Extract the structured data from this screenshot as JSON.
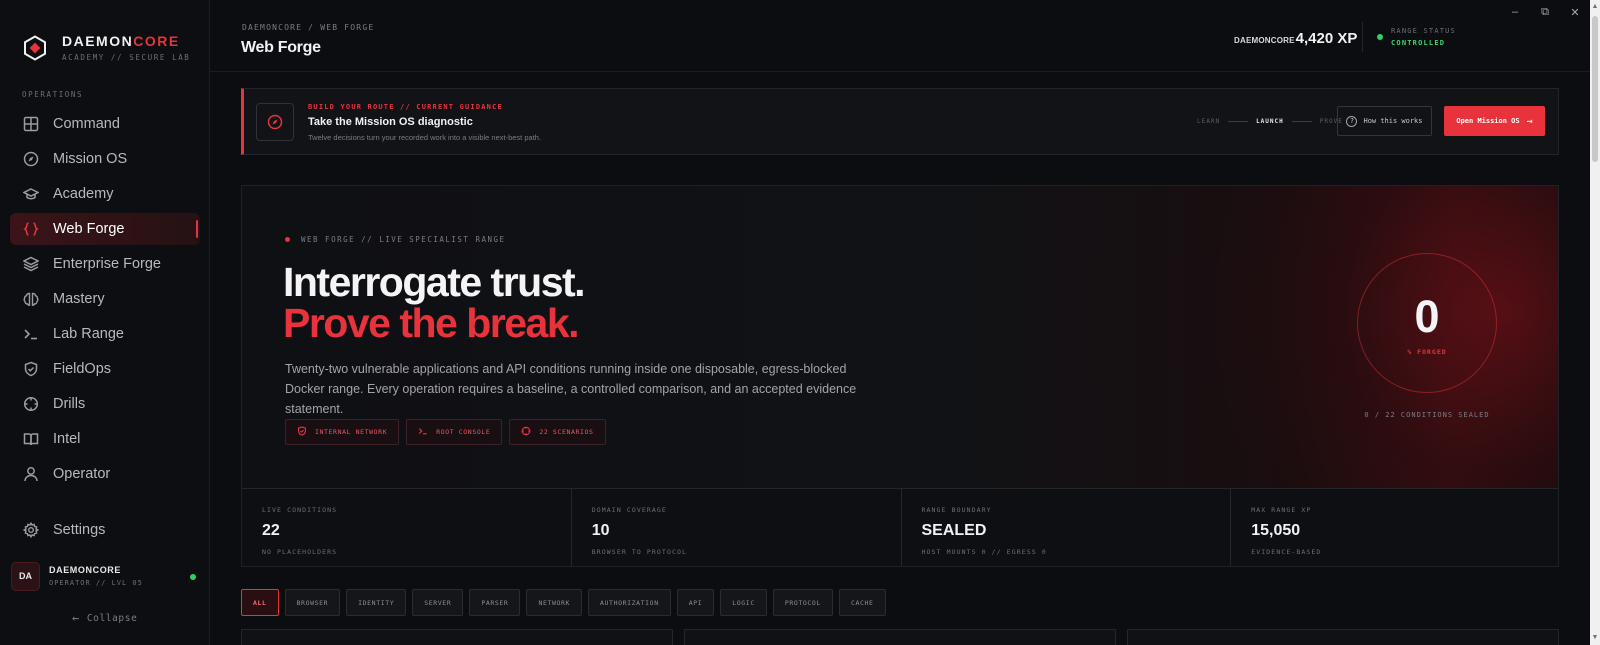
{
  "brand": {
    "name_main": "DAEMON",
    "name_accent": "CORE",
    "tagline": "ACADEMY // SECURE LAB"
  },
  "sidebar": {
    "section_label": "OPERATIONS",
    "items": [
      {
        "label": "Command",
        "icon": "grid-icon"
      },
      {
        "label": "Mission OS",
        "icon": "compass-icon"
      },
      {
        "label": "Academy",
        "icon": "graduation-cap-icon"
      },
      {
        "label": "Web Forge",
        "icon": "braces-icon",
        "active": true
      },
      {
        "label": "Enterprise Forge",
        "icon": "layers-icon"
      },
      {
        "label": "Mastery",
        "icon": "brain-icon"
      },
      {
        "label": "Lab Range",
        "icon": "terminal-icon"
      },
      {
        "label": "FieldOps",
        "icon": "shield-check-icon"
      },
      {
        "label": "Drills",
        "icon": "crosshair-icon"
      },
      {
        "label": "Intel",
        "icon": "book-icon"
      },
      {
        "label": "Operator",
        "icon": "user-icon"
      }
    ],
    "settings_label": "Settings",
    "user": {
      "initials": "DA",
      "name": "DAEMONCORE",
      "level": "OPERATOR // LVL 05"
    },
    "collapse_label": "Collapse"
  },
  "topbar": {
    "breadcrumb": "DAEMONCORE / WEB FORGE",
    "title": "Web Forge",
    "xp_user": "DAEMONCORE",
    "xp_value": "4,420 XP",
    "range_status_label": "RANGE STATUS",
    "range_status_value": "CONTROLLED"
  },
  "guide": {
    "kicker": "BUILD YOUR ROUTE // CURRENT GUIDANCE",
    "title": "Take the Mission OS diagnostic",
    "subtitle": "Twelve decisions turn your recorded work into a visible next-best path.",
    "steps": [
      "LEARN",
      "LAUNCH",
      "PROVE"
    ],
    "how_label": "How this works",
    "open_label": "Open Mission OS"
  },
  "hero": {
    "tag": "WEB FORGE // LIVE SPECIALIST RANGE",
    "headline_1": "Interrogate trust.",
    "headline_2": "Prove the break.",
    "description": "Twenty-two vulnerable applications and API conditions running inside one disposable, egress-blocked Docker range. Every operation requires a baseline, a controlled comparison, and an accepted evidence statement.",
    "chips": [
      {
        "label": "INTERNAL NETWORK",
        "icon": "shield-icon"
      },
      {
        "label": "ROOT CONSOLE",
        "icon": "terminal-icon"
      },
      {
        "label": "22 SCENARIOS",
        "icon": "crosshair-icon"
      }
    ],
    "progress_value": "0",
    "progress_label": "% FORGED",
    "sealed_note": "0 / 22 CONDITIONS SEALED"
  },
  "stats": [
    {
      "key": "LIVE CONDITIONS",
      "value": "22",
      "sub": "NO PLACEHOLDERS"
    },
    {
      "key": "DOMAIN COVERAGE",
      "value": "10",
      "sub": "BROWSER TO PROTOCOL"
    },
    {
      "key": "RANGE BOUNDARY",
      "value": "SEALED",
      "sub": "HOST MOUNTS 0 // EGRESS 0"
    },
    {
      "key": "MAX RANGE XP",
      "value": "15,050",
      "sub": "EVIDENCE-BASED"
    }
  ],
  "filters": [
    "ALL",
    "BROWSER",
    "IDENTITY",
    "SERVER",
    "PARSER",
    "NETWORK",
    "AUTHORIZATION",
    "API",
    "LOGIC",
    "PROTOCOL",
    "CACHE"
  ],
  "colors": {
    "accent": "#e8333c",
    "status_ok": "#2fd068",
    "background": "#0c0d10"
  }
}
